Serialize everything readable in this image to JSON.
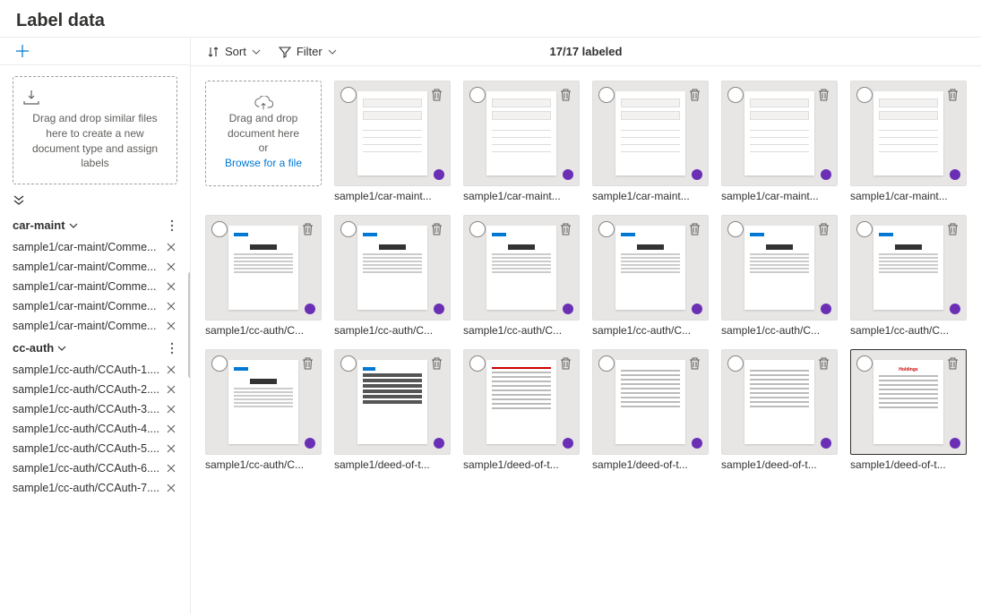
{
  "header": {
    "title": "Label data"
  },
  "sidebar": {
    "dropzone_text": "Drag and drop similar files here to create a new document type and assign labels",
    "groups": [
      {
        "name": "car-maint",
        "files": [
          "sample1/car-maint/Comme...",
          "sample1/car-maint/Comme...",
          "sample1/car-maint/Comme...",
          "sample1/car-maint/Comme...",
          "sample1/car-maint/Comme..."
        ]
      },
      {
        "name": "cc-auth",
        "files": [
          "sample1/cc-auth/CCAuth-1....",
          "sample1/cc-auth/CCAuth-2....",
          "sample1/cc-auth/CCAuth-3....",
          "sample1/cc-auth/CCAuth-4....",
          "sample1/cc-auth/CCAuth-5....",
          "sample1/cc-auth/CCAuth-6....",
          "sample1/cc-auth/CCAuth-7...."
        ]
      }
    ]
  },
  "toolbar": {
    "sort_label": "Sort",
    "filter_label": "Filter",
    "status": "17/17 labeled"
  },
  "main_dropzone": {
    "line1": "Drag and drop document here",
    "line2": "or",
    "browse": "Browse for a file"
  },
  "cards": [
    {
      "caption": "sample1/car-maint...",
      "kind": "invoice"
    },
    {
      "caption": "sample1/car-maint...",
      "kind": "invoice"
    },
    {
      "caption": "sample1/car-maint...",
      "kind": "invoice"
    },
    {
      "caption": "sample1/car-maint...",
      "kind": "invoice"
    },
    {
      "caption": "sample1/car-maint...",
      "kind": "invoice"
    },
    {
      "caption": "sample1/cc-auth/C...",
      "kind": "cc"
    },
    {
      "caption": "sample1/cc-auth/C...",
      "kind": "cc"
    },
    {
      "caption": "sample1/cc-auth/C...",
      "kind": "cc"
    },
    {
      "caption": "sample1/cc-auth/C...",
      "kind": "cc"
    },
    {
      "caption": "sample1/cc-auth/C...",
      "kind": "cc"
    },
    {
      "caption": "sample1/cc-auth/C...",
      "kind": "cc"
    },
    {
      "caption": "sample1/cc-auth/C...",
      "kind": "cc"
    },
    {
      "caption": "sample1/deed-of-t...",
      "kind": "deed-form"
    },
    {
      "caption": "sample1/deed-of-t...",
      "kind": "deed-red"
    },
    {
      "caption": "sample1/deed-of-t...",
      "kind": "deed"
    },
    {
      "caption": "sample1/deed-of-t...",
      "kind": "deed"
    },
    {
      "caption": "sample1/deed-of-t...",
      "kind": "deed-brand",
      "selected": true
    }
  ]
}
